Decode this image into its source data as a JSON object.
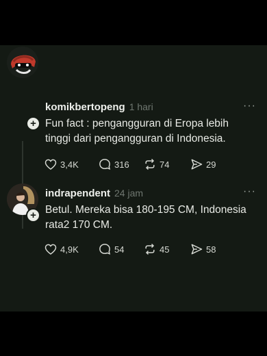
{
  "posts": [
    {
      "username": "komikbertopeng",
      "time": "1 hari",
      "text_line1": "Fun fact : pengangguran di Eropa lebih",
      "text_line2": "tinggi dari pengangguran di Indonesia.",
      "likes": "3,4K",
      "replies": "316",
      "reposts": "74",
      "shares": "29",
      "more": "···"
    },
    {
      "username": "indrapendent",
      "time": "24 jam",
      "text_line1": "Betul. Mereka bisa 180-195 CM, Indonesia",
      "text_line2": "rata2 170 CM.",
      "likes": "4,9K",
      "replies": "54",
      "reposts": "45",
      "shares": "58",
      "more": "···"
    }
  ],
  "follow_icon": "+",
  "icons": [
    "heart-icon",
    "reply-icon",
    "repost-icon",
    "share-icon",
    "more-icon",
    "follow-icon"
  ]
}
